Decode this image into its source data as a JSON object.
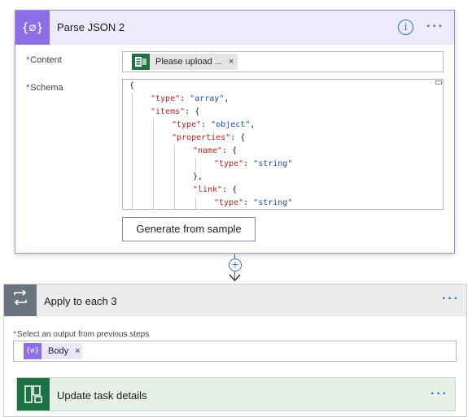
{
  "parse_json": {
    "title": "Parse JSON 2",
    "icon": "{∅}",
    "more": "···",
    "info": "i",
    "content_label": "Content",
    "schema_label": "Schema",
    "required_mark": "*",
    "content_token": {
      "text": "Please upload ...",
      "remove": "×",
      "icon": "excel-forms-icon"
    },
    "schema_lines": [
      [
        {
          "t": "p",
          "v": "{"
        }
      ],
      [
        {
          "t": "k",
          "v": "\"type\""
        },
        {
          "t": "p",
          "v": ": "
        },
        {
          "t": "s",
          "v": "\"array\""
        },
        {
          "t": "p",
          "v": ","
        }
      ],
      [
        {
          "t": "k",
          "v": "\"items\""
        },
        {
          "t": "p",
          "v": ": {"
        }
      ],
      [
        {
          "t": "k",
          "v": "\"type\""
        },
        {
          "t": "p",
          "v": ": "
        },
        {
          "t": "s",
          "v": "\"object\""
        },
        {
          "t": "p",
          "v": ","
        }
      ],
      [
        {
          "t": "k",
          "v": "\"properties\""
        },
        {
          "t": "p",
          "v": ": {"
        }
      ],
      [
        {
          "t": "k",
          "v": "\"name\""
        },
        {
          "t": "p",
          "v": ": {"
        }
      ],
      [
        {
          "t": "k",
          "v": "\"type\""
        },
        {
          "t": "p",
          "v": ": "
        },
        {
          "t": "s",
          "v": "\"string\""
        }
      ],
      [
        {
          "t": "p",
          "v": "},"
        }
      ],
      [
        {
          "t": "k",
          "v": "\"link\""
        },
        {
          "t": "p",
          "v": ": {"
        }
      ],
      [
        {
          "t": "k",
          "v": "\"type\""
        },
        {
          "t": "p",
          "v": ": "
        },
        {
          "t": "s",
          "v": "\"string\""
        }
      ]
    ],
    "generate_button": "Generate from sample"
  },
  "connector": {
    "add": "+",
    "arrow": "▼"
  },
  "apply_each": {
    "title": "Apply to each 3",
    "more": "···",
    "icon": "⟲",
    "output_label": "Select an output from previous steps",
    "required_mark": "*",
    "body_token": {
      "text": "Body",
      "remove": "×",
      "icon": "{∅}"
    },
    "inner_action": {
      "title": "Update task details",
      "more": "···",
      "icon": "planner-icon"
    }
  }
}
